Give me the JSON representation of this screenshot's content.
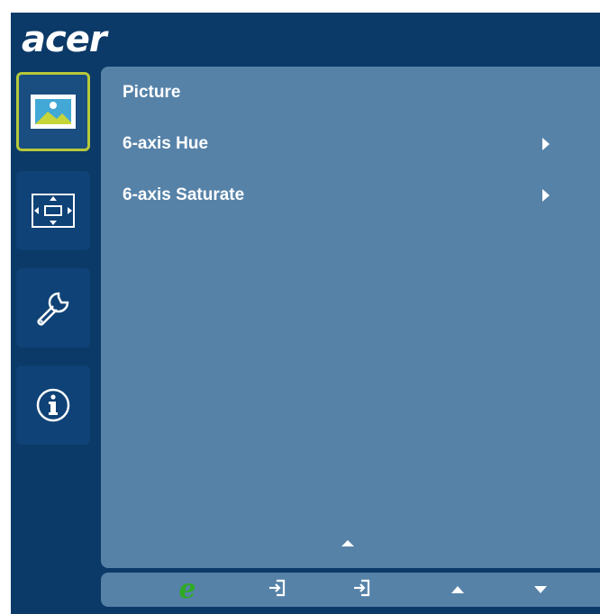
{
  "brand": {
    "logo_text": "acer"
  },
  "sidebar": {
    "items": [
      {
        "icon": "picture-icon",
        "active": true
      },
      {
        "icon": "display-position-icon",
        "active": false
      },
      {
        "icon": "settings-wrench-icon",
        "active": false
      },
      {
        "icon": "info-icon",
        "active": false
      }
    ]
  },
  "menu": {
    "title": "Picture",
    "items": [
      {
        "label": "6-axis Hue",
        "has_submenu": true
      },
      {
        "label": "6-axis Saturate",
        "has_submenu": true
      }
    ]
  },
  "bottom_bar": {
    "e_button_label": "e",
    "buttons": [
      "e-mode-button",
      "input-button",
      "input-button",
      "up-button",
      "down-button"
    ]
  },
  "colors": {
    "frame": "#0c3a68",
    "panel": "#5682a8",
    "active_border": "#b6c83a",
    "e_green": "#2faa23"
  }
}
